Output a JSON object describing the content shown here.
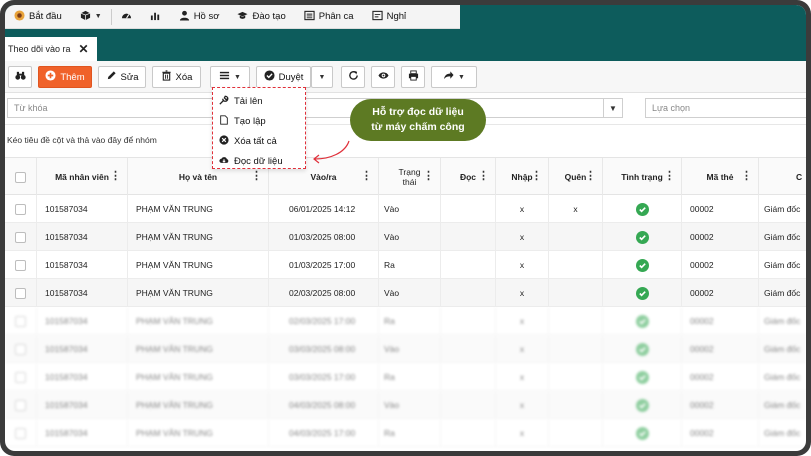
{
  "menu": {
    "start": "Bắt đầu",
    "profile": "Hồ sơ",
    "training": "Đào tạo",
    "shift": "Phân ca",
    "leave": "Nghỉ"
  },
  "tab": {
    "label": "Theo dõi vào ra"
  },
  "toolbar": {
    "add": "Thêm",
    "edit": "Sửa",
    "delete": "Xóa",
    "approve": "Duyệt"
  },
  "filters": {
    "keyword_placeholder": "Từ khóa",
    "select_placeholder": "Lựa chọn"
  },
  "group_hint": "Kéo tiêu đề cột và thả vào đây để nhóm",
  "dropdown": {
    "items": [
      "Tải lên",
      "Tạo lập",
      "Xóa tất cả",
      "Đọc dữ liệu"
    ]
  },
  "callout": {
    "line1": "Hỗ trợ đọc dữ liệu",
    "line2": "từ máy chấm công"
  },
  "columns": [
    "Mã nhân viên",
    "Họ và tên",
    "Vào/ra",
    "Trạng thái",
    "Đọc",
    "Nhập",
    "Quên",
    "Tình trạng",
    "Mã thẻ",
    "C"
  ],
  "rows": [
    {
      "id": "101587034",
      "name": "PHẠM VĂN TRUNG",
      "time": "06/01/2025 14:12",
      "status": "Vào",
      "doc": "",
      "nhap": "x",
      "quen": "x",
      "card": "00002",
      "cv": "Giám đốc"
    },
    {
      "id": "101587034",
      "name": "PHẠM VĂN TRUNG",
      "time": "01/03/2025 08:00",
      "status": "Vào",
      "doc": "",
      "nhap": "x",
      "quen": "",
      "card": "00002",
      "cv": "Giám đốc"
    },
    {
      "id": "101587034",
      "name": "PHẠM VĂN TRUNG",
      "time": "01/03/2025 17:00",
      "status": "Ra",
      "doc": "",
      "nhap": "x",
      "quen": "",
      "card": "00002",
      "cv": "Giám đốc"
    },
    {
      "id": "101587034",
      "name": "PHẠM VĂN TRUNG",
      "time": "02/03/2025 08:00",
      "status": "Vào",
      "doc": "",
      "nhap": "x",
      "quen": "",
      "card": "00002",
      "cv": "Giám đốc"
    },
    {
      "id": "101587034",
      "name": "PHẠM VĂN TRUNG",
      "time": "02/03/2025 17:00",
      "status": "Ra",
      "doc": "",
      "nhap": "x",
      "quen": "",
      "card": "00002",
      "cv": "Giám đốc"
    },
    {
      "id": "101587034",
      "name": "PHẠM VĂN TRUNG",
      "time": "03/03/2025 08:00",
      "status": "Vào",
      "doc": "",
      "nhap": "x",
      "quen": "",
      "card": "00002",
      "cv": "Giám đốc"
    },
    {
      "id": "101587034",
      "name": "PHẠM VĂN TRUNG",
      "time": "03/03/2025 17:00",
      "status": "Ra",
      "doc": "",
      "nhap": "x",
      "quen": "",
      "card": "00002",
      "cv": "Giám đốc"
    },
    {
      "id": "101587034",
      "name": "PHẠM VĂN TRUNG",
      "time": "04/03/2025 08:00",
      "status": "Vào",
      "doc": "",
      "nhap": "x",
      "quen": "",
      "card": "00002",
      "cv": "Giám đốc"
    },
    {
      "id": "101587034",
      "name": "PHẠM VĂN TRUNG",
      "time": "04/03/2025 17:00",
      "status": "Ra",
      "doc": "",
      "nhap": "x",
      "quen": "",
      "card": "00002",
      "cv": "Giám đốc"
    }
  ],
  "colors": {
    "accent": "#f0622a",
    "header_bg": "#0d5c5c",
    "ok": "#35a853",
    "callout": "#5d7a23",
    "dashed_highlight": "#e0303a"
  }
}
